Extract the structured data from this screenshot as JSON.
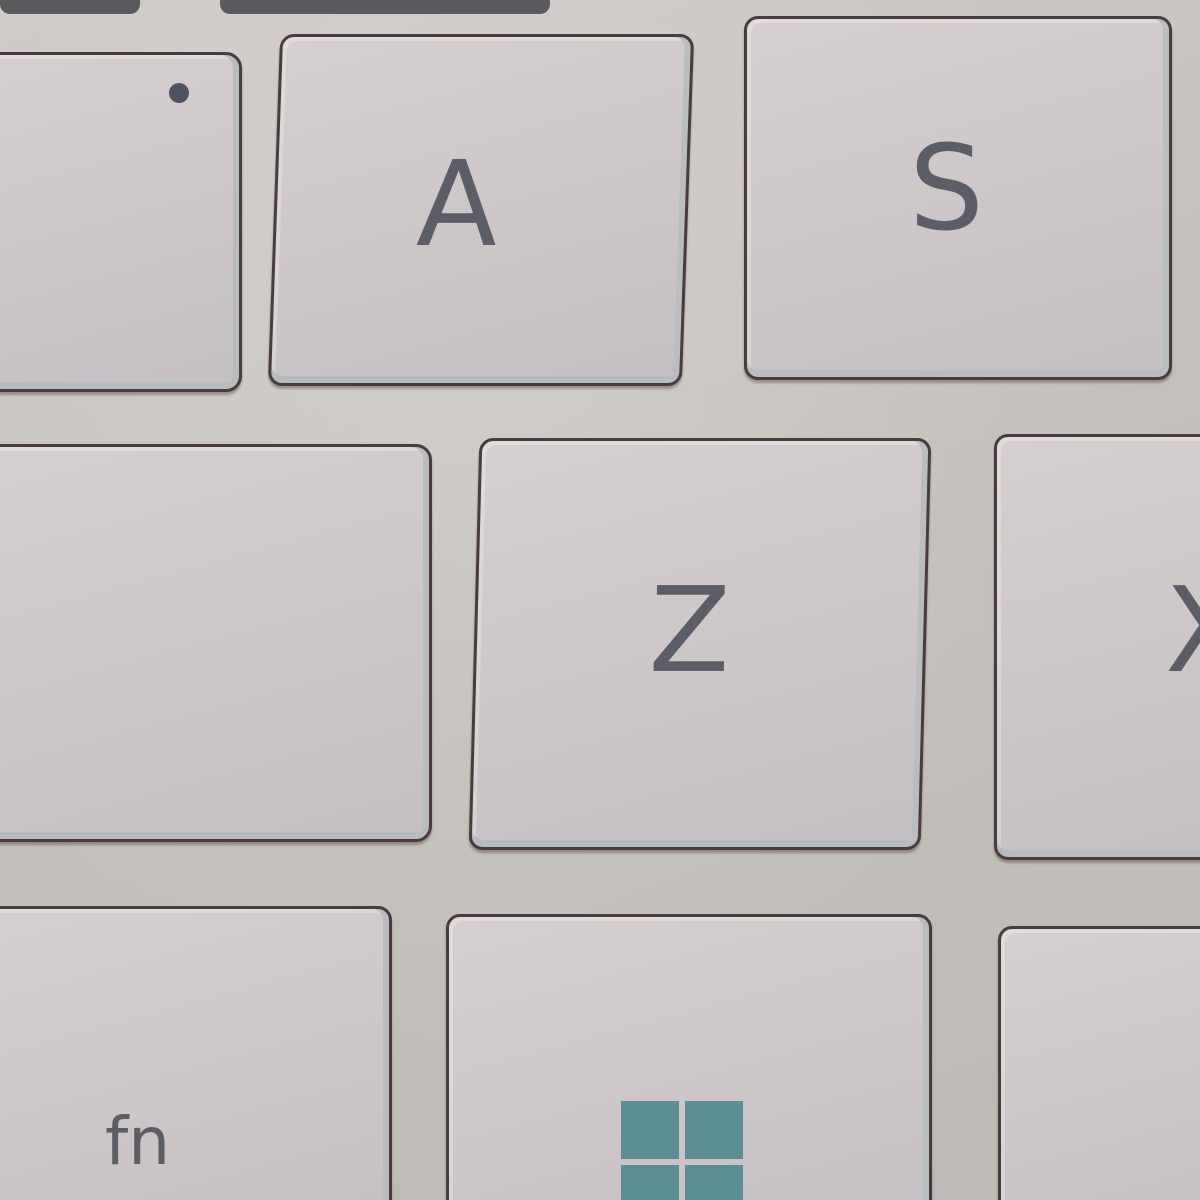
{
  "keyboard": {
    "keys": {
      "caps": {
        "label": ""
      },
      "a": {
        "label": "A"
      },
      "s": {
        "label": "S"
      },
      "shift": {
        "label": ""
      },
      "z": {
        "label": "Z"
      },
      "x": {
        "label": "X"
      },
      "fn": {
        "label": "fn"
      },
      "windows": {
        "label": "",
        "icon": "windows-logo-icon"
      },
      "alt": {
        "label": ""
      }
    },
    "colors": {
      "key_surface": "#d0cacb",
      "legend": "#5c5d66",
      "windows_logo": "#5b8e96",
      "caps_indicator": "#4f5260"
    }
  }
}
